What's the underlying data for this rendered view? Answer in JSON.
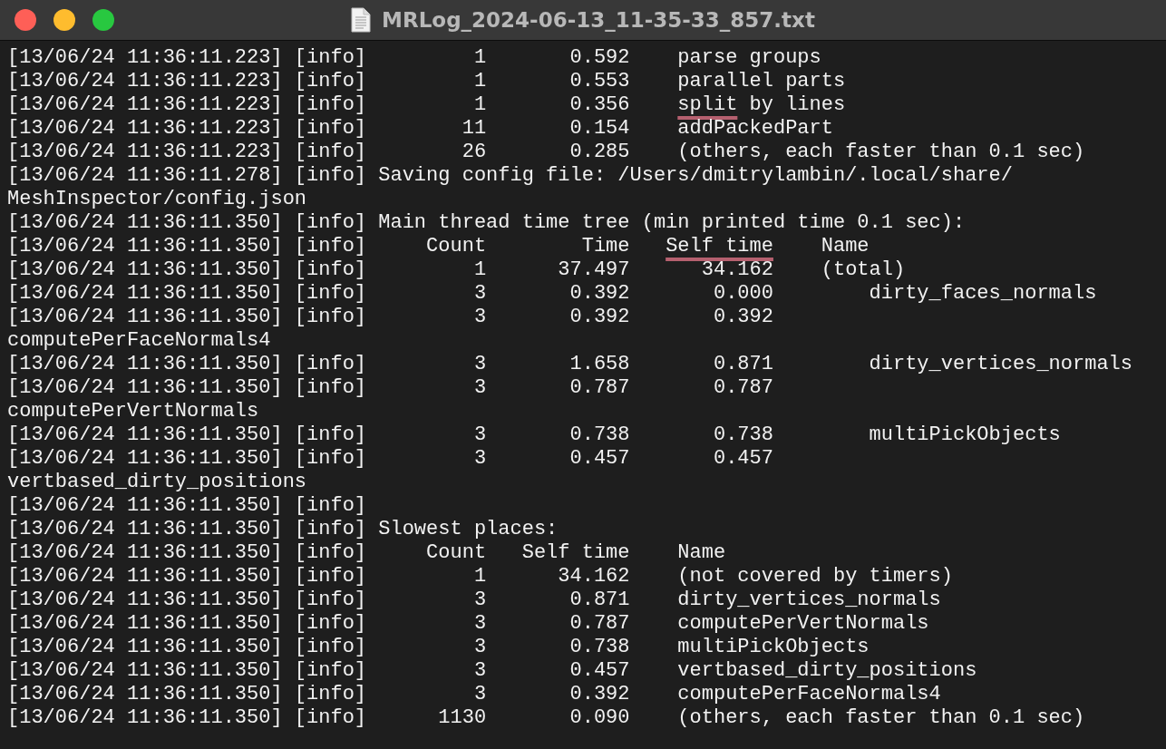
{
  "window": {
    "title": "MRLog_2024-06-13_11-35-33_857.txt"
  },
  "lines": [
    {
      "segments": [
        {
          "text": "[13/06/24 11:36:11.223] [info]         1       0.592    parse groups",
          "underlined": false
        }
      ]
    },
    {
      "segments": [
        {
          "text": "[13/06/24 11:36:11.223] [info]         1       0.553    parallel parts",
          "underlined": false
        }
      ]
    },
    {
      "segments": [
        {
          "text": "[13/06/24 11:36:11.223] [info]         1       0.356    ",
          "underlined": false
        },
        {
          "text": "split",
          "underlined": true
        },
        {
          "text": " by lines",
          "underlined": false
        }
      ]
    },
    {
      "segments": [
        {
          "text": "[13/06/24 11:36:11.223] [info]        11       0.154    addPackedPart",
          "underlined": false
        }
      ]
    },
    {
      "segments": [
        {
          "text": "[13/06/24 11:36:11.223] [info]        26       0.285    (others, each faster than 0.1 sec)",
          "underlined": false
        }
      ]
    },
    {
      "segments": [
        {
          "text": "[13/06/24 11:36:11.278] [info] Saving config file: /Users/dmitrylambin/.local/share/",
          "underlined": false
        }
      ]
    },
    {
      "segments": [
        {
          "text": "MeshInspector/config.json",
          "underlined": false
        }
      ]
    },
    {
      "segments": [
        {
          "text": "[13/06/24 11:36:11.350] [info] Main thread time tree (min printed time 0.1 sec):",
          "underlined": false
        }
      ]
    },
    {
      "segments": [
        {
          "text": "[13/06/24 11:36:11.350] [info]     Count        Time   ",
          "underlined": false
        },
        {
          "text": "Self time",
          "underlined": true
        },
        {
          "text": "    Name",
          "underlined": false
        }
      ]
    },
    {
      "segments": [
        {
          "text": "[13/06/24 11:36:11.350] [info]         1      37.497      34.162    (total)",
          "underlined": false
        }
      ]
    },
    {
      "segments": [
        {
          "text": "[13/06/24 11:36:11.350] [info]         3       0.392       0.000        dirty_faces_normals",
          "underlined": false
        }
      ]
    },
    {
      "segments": [
        {
          "text": "[13/06/24 11:36:11.350] [info]         3       0.392       0.392",
          "underlined": false
        }
      ]
    },
    {
      "segments": [
        {
          "text": "computePerFaceNormals4",
          "underlined": false
        }
      ]
    },
    {
      "segments": [
        {
          "text": "[13/06/24 11:36:11.350] [info]         3       1.658       0.871        dirty_vertices_normals",
          "underlined": false
        }
      ]
    },
    {
      "segments": [
        {
          "text": "[13/06/24 11:36:11.350] [info]         3       0.787       0.787",
          "underlined": false
        }
      ]
    },
    {
      "segments": [
        {
          "text": "computePerVertNormals",
          "underlined": false
        }
      ]
    },
    {
      "segments": [
        {
          "text": "[13/06/24 11:36:11.350] [info]         3       0.738       0.738        multiPickObjects",
          "underlined": false
        }
      ]
    },
    {
      "segments": [
        {
          "text": "[13/06/24 11:36:11.350] [info]         3       0.457       0.457",
          "underlined": false
        }
      ]
    },
    {
      "segments": [
        {
          "text": "vertbased_dirty_positions",
          "underlined": false
        }
      ]
    },
    {
      "segments": [
        {
          "text": "[13/06/24 11:36:11.350] [info]",
          "underlined": false
        }
      ]
    },
    {
      "segments": [
        {
          "text": "[13/06/24 11:36:11.350] [info] Slowest places:",
          "underlined": false
        }
      ]
    },
    {
      "segments": [
        {
          "text": "[13/06/24 11:36:11.350] [info]     Count   Self time    Name",
          "underlined": false
        }
      ]
    },
    {
      "segments": [
        {
          "text": "[13/06/24 11:36:11.350] [info]         1      34.162    (not covered by timers)",
          "underlined": false
        }
      ]
    },
    {
      "segments": [
        {
          "text": "[13/06/24 11:36:11.350] [info]         3       0.871    dirty_vertices_normals",
          "underlined": false
        }
      ]
    },
    {
      "segments": [
        {
          "text": "[13/06/24 11:36:11.350] [info]         3       0.787    computePerVertNormals",
          "underlined": false
        }
      ]
    },
    {
      "segments": [
        {
          "text": "[13/06/24 11:36:11.350] [info]         3       0.738    multiPickObjects",
          "underlined": false
        }
      ]
    },
    {
      "segments": [
        {
          "text": "[13/06/24 11:36:11.350] [info]         3       0.457    vertbased_dirty_positions",
          "underlined": false
        }
      ]
    },
    {
      "segments": [
        {
          "text": "[13/06/24 11:36:11.350] [info]         3       0.392    computePerFaceNormals4",
          "underlined": false
        }
      ]
    },
    {
      "segments": [
        {
          "text": "[13/06/24 11:36:11.350] [info]      1130       0.090    (others, each faster than 0.1 sec)",
          "underlined": false
        }
      ]
    }
  ]
}
